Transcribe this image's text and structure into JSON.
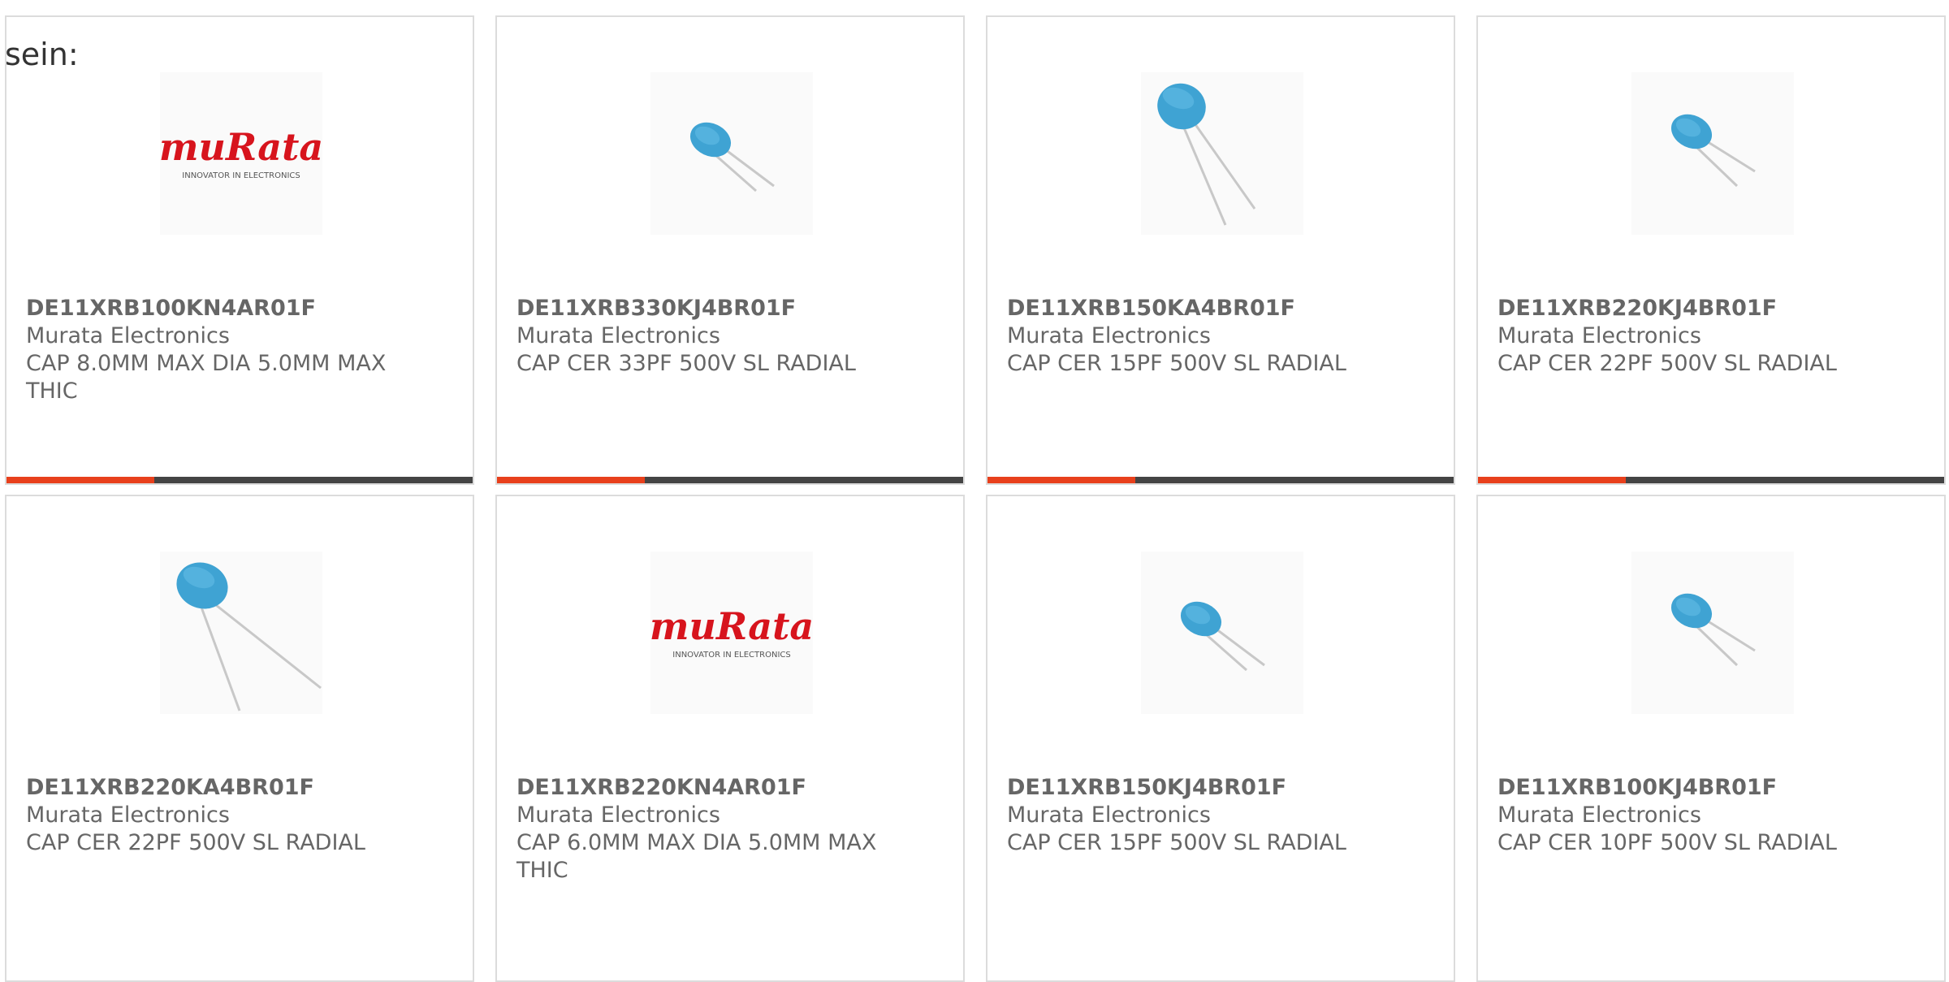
{
  "intro_text": "sein:",
  "products": [
    {
      "part_number": "DE11XRB100KN4AR01F",
      "manufacturer": "Murata Electronics",
      "description": "CAP 8.0MM MAX DIA 5.0MM MAX THIC",
      "image": "murata-logo",
      "logo_name": "muRata",
      "logo_tagline": "INNOVATOR IN ELECTRONICS"
    },
    {
      "part_number": "DE11XRB330KJ4BR01F",
      "manufacturer": "Murata Electronics",
      "description": "CAP CER 33PF 500V SL RADIAL",
      "image": "capacitor-small"
    },
    {
      "part_number": "DE11XRB150KA4BR01F",
      "manufacturer": "Murata Electronics",
      "description": "CAP CER 15PF 500V SL RADIAL",
      "image": "capacitor-large"
    },
    {
      "part_number": "DE11XRB220KJ4BR01F",
      "manufacturer": "Murata Electronics",
      "description": "CAP CER 22PF 500V SL RADIAL",
      "image": "capacitor-small"
    },
    {
      "part_number": "DE11XRB220KA4BR01F",
      "manufacturer": "Murata Electronics",
      "description": "CAP CER 22PF 500V SL RADIAL",
      "image": "capacitor-large"
    },
    {
      "part_number": "DE11XRB220KN4AR01F",
      "manufacturer": "Murata Electronics",
      "description": "CAP 6.0MM MAX DIA 5.0MM MAX THIC",
      "image": "murata-logo",
      "logo_name": "muRata",
      "logo_tagline": "INNOVATOR IN ELECTRONICS"
    },
    {
      "part_number": "DE11XRB150KJ4BR01F",
      "manufacturer": "Murata Electronics",
      "description": "CAP CER 15PF 500V SL RADIAL",
      "image": "capacitor-small"
    },
    {
      "part_number": "DE11XRB100KJ4BR01F",
      "manufacturer": "Murata Electronics",
      "description": "CAP CER 10PF 500V SL RADIAL",
      "image": "capacitor-small"
    }
  ],
  "colors": {
    "accent": "#e8401c",
    "bar_dark": "#444444",
    "text": "#666666",
    "capacitor_blue": "#3fa3d3",
    "logo_red": "#d7141d"
  }
}
